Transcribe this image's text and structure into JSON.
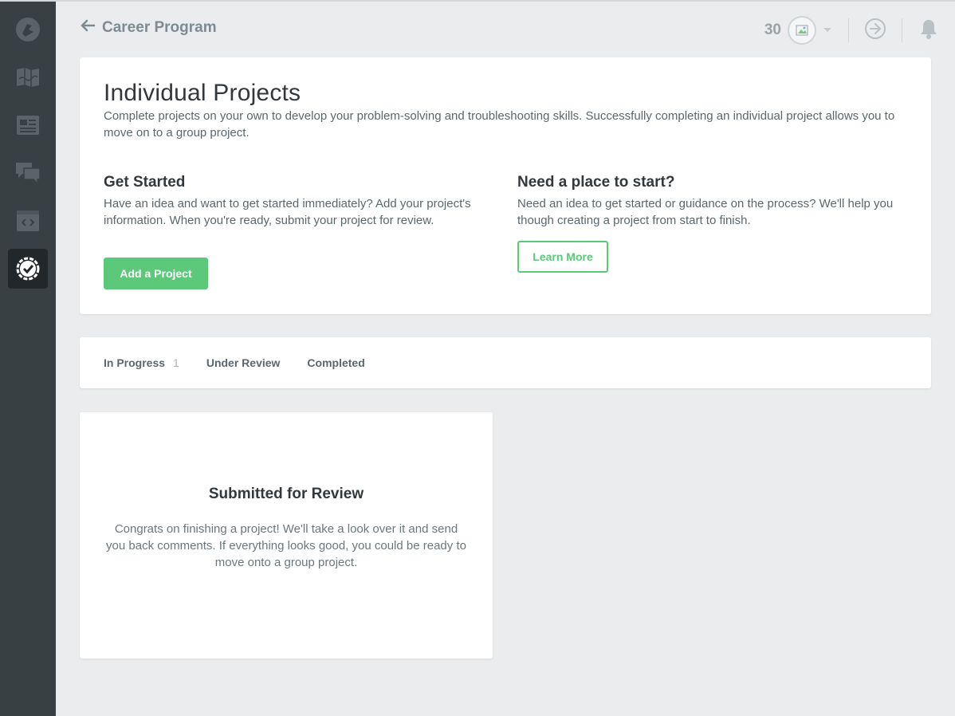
{
  "header": {
    "back_label": "Career Program",
    "points": "30"
  },
  "sidebar": {
    "items": [
      {
        "name": "logo-icon"
      },
      {
        "name": "library-icon"
      },
      {
        "name": "tracks-icon"
      },
      {
        "name": "community-icon"
      },
      {
        "name": "workspaces-icon"
      },
      {
        "name": "projects-icon",
        "active": true
      }
    ]
  },
  "intro": {
    "title": "Individual Projects",
    "description": "Complete projects on your own to develop your problem-solving and troubleshooting skills. Successfully completing an individual project allows you to move on to a group project.",
    "get_started": {
      "heading": "Get Started",
      "text": "Have an idea and want to get started immediately? Add your project's information. When you're ready, submit your project for review.",
      "button": "Add a Project"
    },
    "need_place": {
      "heading": "Need a place to start?",
      "text": "Need an idea to get started or guidance on the process? We'll help you though creating a project from start to finish.",
      "button": "Learn More"
    }
  },
  "tabs": [
    {
      "label": "In Progress",
      "count": "1"
    },
    {
      "label": "Under Review"
    },
    {
      "label": "Completed"
    }
  ],
  "status": {
    "title": "Submitted for Review",
    "text": "Congrats on finishing a project! We'll take a look over it and send you back comments. If everything looks good, you could be ready to move onto a group project."
  },
  "colors": {
    "accent": "#5cc87a",
    "sidebar": "#394044"
  }
}
